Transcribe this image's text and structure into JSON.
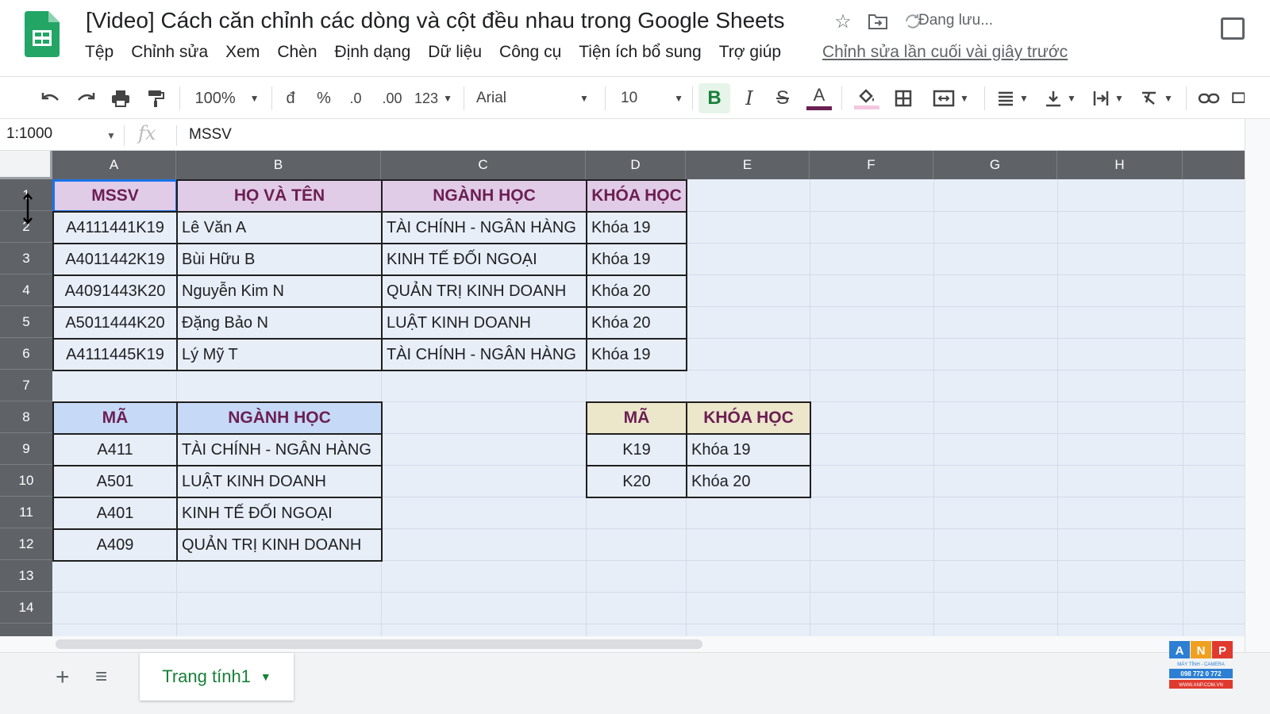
{
  "header": {
    "doc_title": "[Video] Cách căn chỉnh các dòng và cột đều nhau trong Google Sheets",
    "saving_status": "Đang lưu...",
    "menus": [
      "Tệp",
      "Chỉnh sửa",
      "Xem",
      "Chèn",
      "Định dạng",
      "Dữ liệu",
      "Công cụ",
      "Tiện ích bổ sung",
      "Trợ giúp"
    ],
    "last_edit": "Chỉnh sửa lần cuối vài giây trước"
  },
  "toolbar": {
    "zoom": "100%",
    "currency": "đ",
    "percent": "%",
    "decrease_decimal": ".0",
    "increase_decimal": ".00",
    "more_formats": "123",
    "font": "Arial",
    "font_size": "10",
    "bold": "B",
    "italic": "I",
    "strike": "S",
    "text_color": "A",
    "accent_color": "#188038",
    "text_color_bar": "#6b1f52"
  },
  "formula_bar": {
    "name_box": "1:1000",
    "fx": "fx",
    "value": "MSSV"
  },
  "columns": [
    "A",
    "B",
    "C",
    "D",
    "E",
    "F",
    "G",
    "H"
  ],
  "rows": [
    "1",
    "2",
    "3",
    "4",
    "5",
    "6",
    "7",
    "8",
    "9",
    "10",
    "11",
    "12",
    "13",
    "14"
  ],
  "table_students": {
    "headers": [
      "MSSV",
      "HỌ VÀ TÊN",
      "NGÀNH HỌC",
      "KHÓA HỌC"
    ],
    "rows": [
      [
        "A4111441K19",
        "Lê Văn A",
        "TÀI CHÍNH - NGÂN HÀNG",
        "Khóa 19"
      ],
      [
        "A4011442K19",
        "Bùi Hữu B",
        "KINH TẾ ĐỐI NGOẠI",
        "Khóa 19"
      ],
      [
        "A4091443K20",
        "Nguyễn Kim N",
        "QUẢN TRỊ KINH DOANH",
        "Khóa 20"
      ],
      [
        "A5011444K20",
        "Đặng Bảo N",
        "LUẬT KINH DOANH",
        "Khóa 20"
      ],
      [
        "A4111445K19",
        "Lý Mỹ T",
        "TÀI CHÍNH - NGÂN HÀNG",
        "Khóa 19"
      ]
    ]
  },
  "table_majors": {
    "headers": [
      "MÃ",
      "NGÀNH HỌC"
    ],
    "rows": [
      [
        "A411",
        "TÀI CHÍNH - NGÂN HÀNG"
      ],
      [
        "A501",
        "LUẬT KINH DOANH"
      ],
      [
        "A401",
        "KINH TẾ ĐỐI NGOẠI"
      ],
      [
        "A409",
        "QUẢN TRỊ KINH DOANH"
      ]
    ]
  },
  "table_courses": {
    "headers": [
      "MÃ",
      "KHÓA HỌC"
    ],
    "rows": [
      [
        "K19",
        "Khóa 19"
      ],
      [
        "K20",
        "Khóa 20"
      ]
    ]
  },
  "header_fill_colors": {
    "students": "#e1cce8",
    "majors": "#c6d9f6",
    "courses": "#ece6cb"
  },
  "sheet_tab": {
    "name": "Trang tính1"
  },
  "watermark": {
    "letters": [
      "A",
      "N",
      "P"
    ],
    "line1": "MÁY TÍNH - CAMERA",
    "line2": "098 772 0 772",
    "line3": "WWW.ANP.COM.VN"
  }
}
